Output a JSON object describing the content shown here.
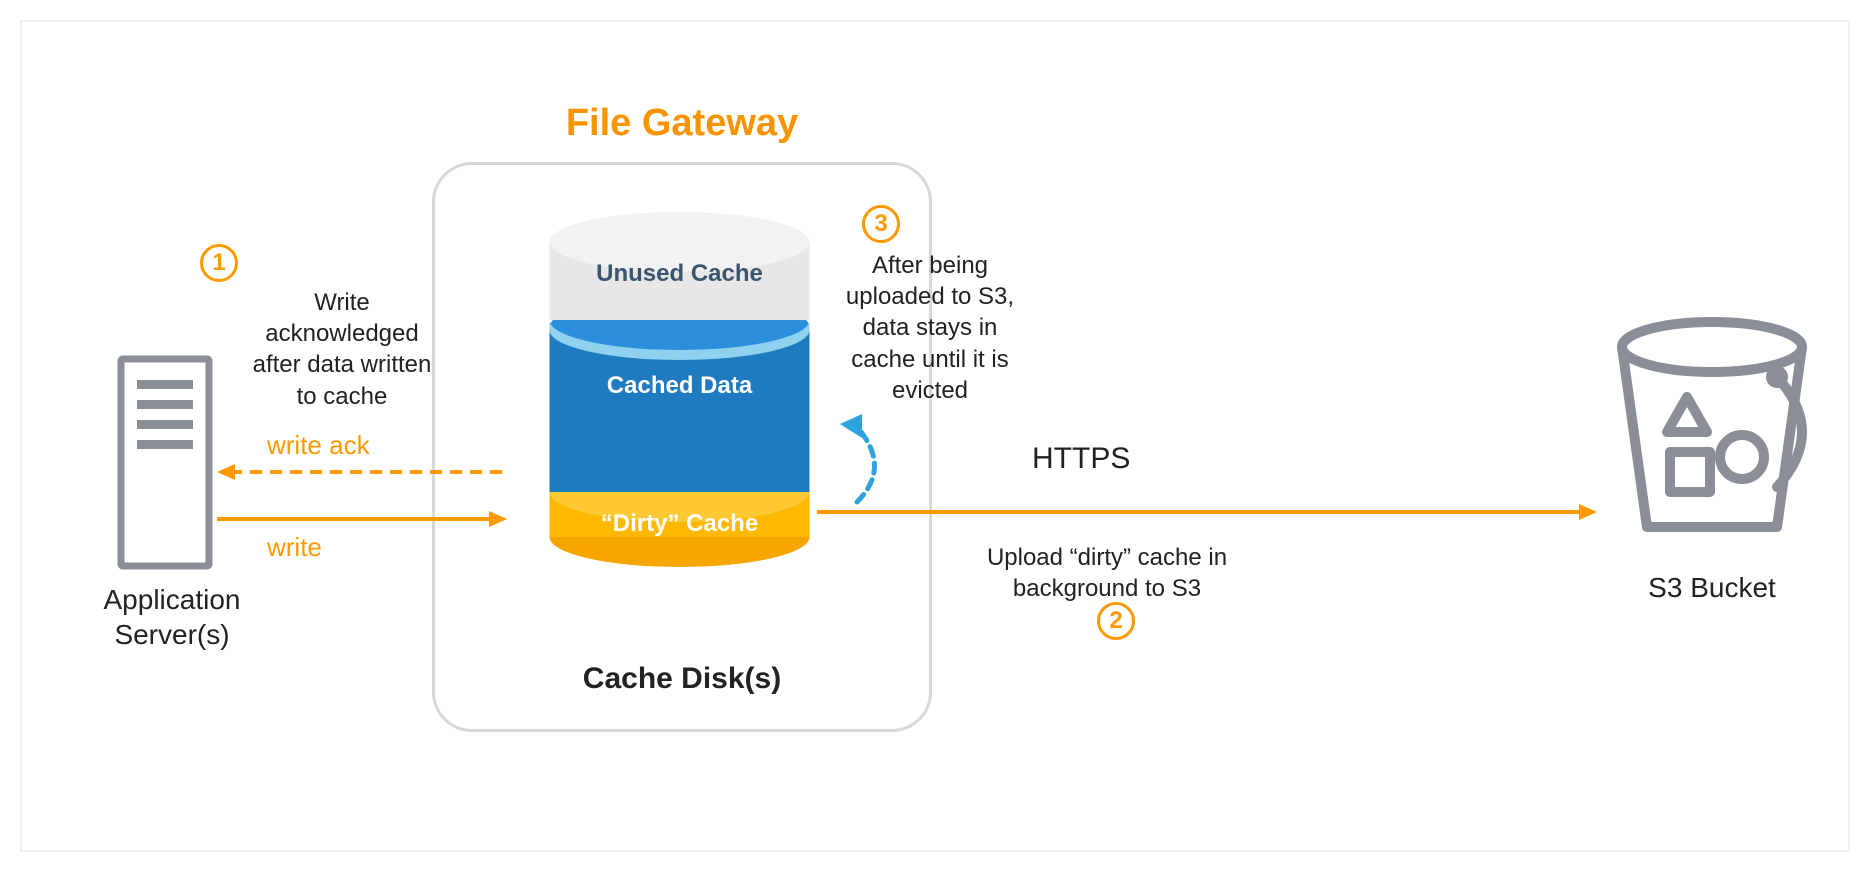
{
  "title": "File Gateway",
  "app_server_label": "Application\nServer(s)",
  "cache_disk_label": "Cache Disk(s)",
  "s3_bucket_label": "S3 Bucket",
  "cylinder": {
    "unused": "Unused Cache",
    "cached": "Cached Data",
    "dirty": "“Dirty” Cache"
  },
  "steps": {
    "s1": "1",
    "s2": "2",
    "s3": "3"
  },
  "descriptions": {
    "d1": "Write acknowledged after data written to cache",
    "d3": "After being uploaded to S3, data stays in cache until it is evicted",
    "upload": "Upload “dirty” cache in background to S3"
  },
  "https": "HTTPS",
  "flow": {
    "write_ack": "write ack",
    "write": "write"
  },
  "colors": {
    "orange": "#ff9900",
    "blue": "#1f7bbf",
    "darkblue": "#146eb4",
    "lightblue": "#61c3e6",
    "grey": "#888888",
    "cyltop": "#e0e0e0"
  }
}
